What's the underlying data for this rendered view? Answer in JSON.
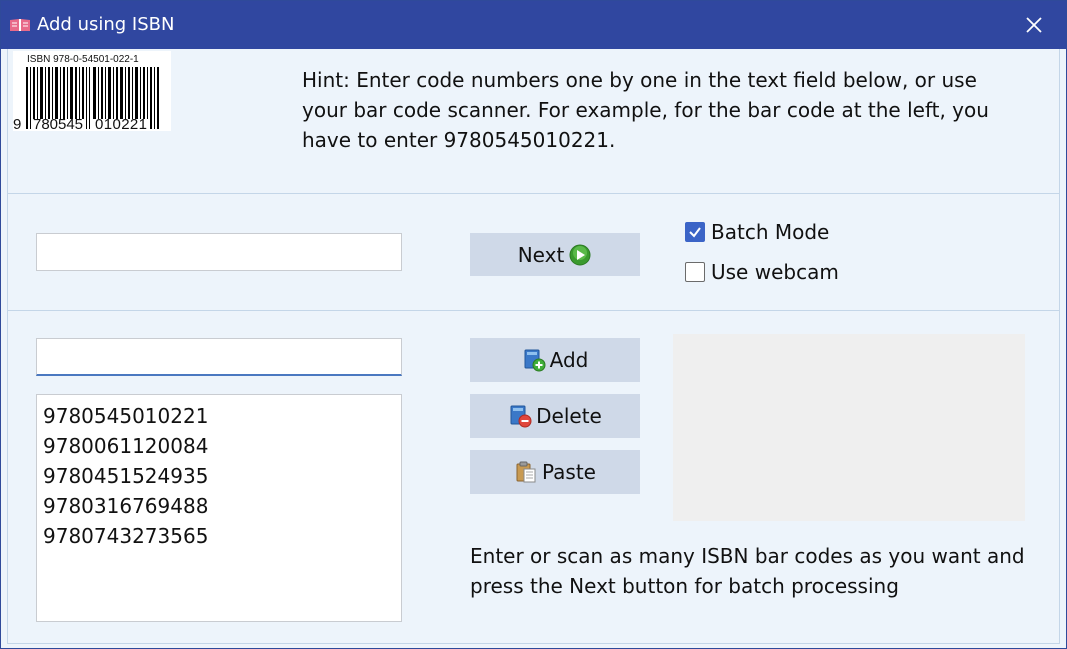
{
  "window": {
    "title": "Add using ISBN"
  },
  "barcode": {
    "isbn_label": "ISBN 978-0-54501-022-1",
    "digit_first": "9",
    "digits_left": "780545",
    "digits_right": "010221"
  },
  "hint": {
    "text": "Hint: Enter code numbers one by one in the text field below, or use your bar code scanner. For example, for the bar code at the left, you have to enter 9780545010221."
  },
  "scan": {
    "input_value": "",
    "next_label": "Next",
    "batch_mode_label": "Batch Mode",
    "batch_mode_checked": true,
    "use_webcam_label": "Use webcam",
    "use_webcam_checked": false
  },
  "batch": {
    "entry_value": "",
    "add_label": "Add",
    "delete_label": "Delete",
    "paste_label": "Paste",
    "items": [
      "9780545010221",
      "9780061120084",
      "9780451524935",
      "9780316769488",
      "9780743273565"
    ],
    "footer_hint": "Enter or scan as many ISBN bar codes as you want and press the Next button for batch processing"
  },
  "colors": {
    "titlebar": "#3047a0",
    "panel": "#edf4fb",
    "button": "#cfd9e8",
    "accent": "#3b64c7"
  }
}
